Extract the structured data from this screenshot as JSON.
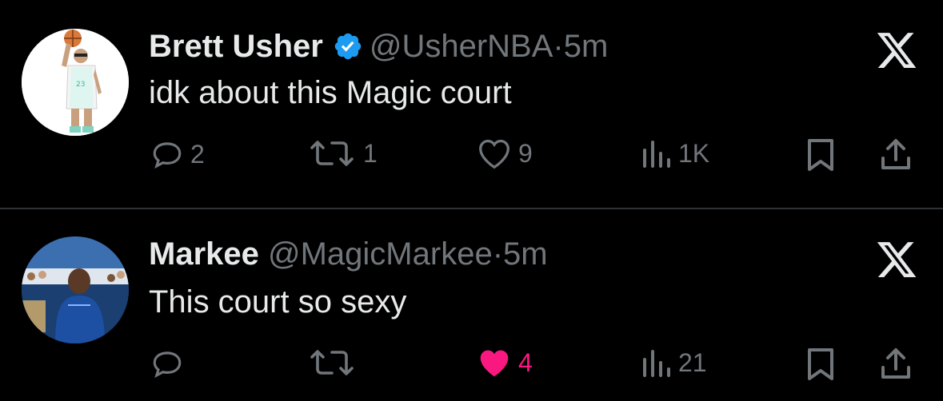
{
  "colors": {
    "background": "#000000",
    "primary_text": "#e7e9ea",
    "secondary_text": "#71767b",
    "divider": "#2f3336",
    "verified_blue": "#1d9bf0",
    "like_pink": "#f91880"
  },
  "tweets": [
    {
      "display_name": "Brett Usher",
      "verified": true,
      "handle": "@UsherNBA",
      "separator": "·",
      "time": "5m",
      "text": "idk about this Magic court",
      "avatar_icon": "user-avatar",
      "platform_icon": "x-logo-icon",
      "actions": {
        "replies": "2",
        "retweets": "1",
        "likes": "9",
        "liked": false,
        "views": "1K"
      }
    },
    {
      "display_name": "Markee",
      "verified": false,
      "handle": "@MagicMarkee",
      "separator": "·",
      "time": "5m",
      "text": "This court so sexy",
      "avatar_icon": "user-avatar",
      "platform_icon": "x-logo-icon",
      "actions": {
        "replies": "",
        "retweets": "",
        "likes": "4",
        "liked": true,
        "views": "21"
      }
    }
  ]
}
